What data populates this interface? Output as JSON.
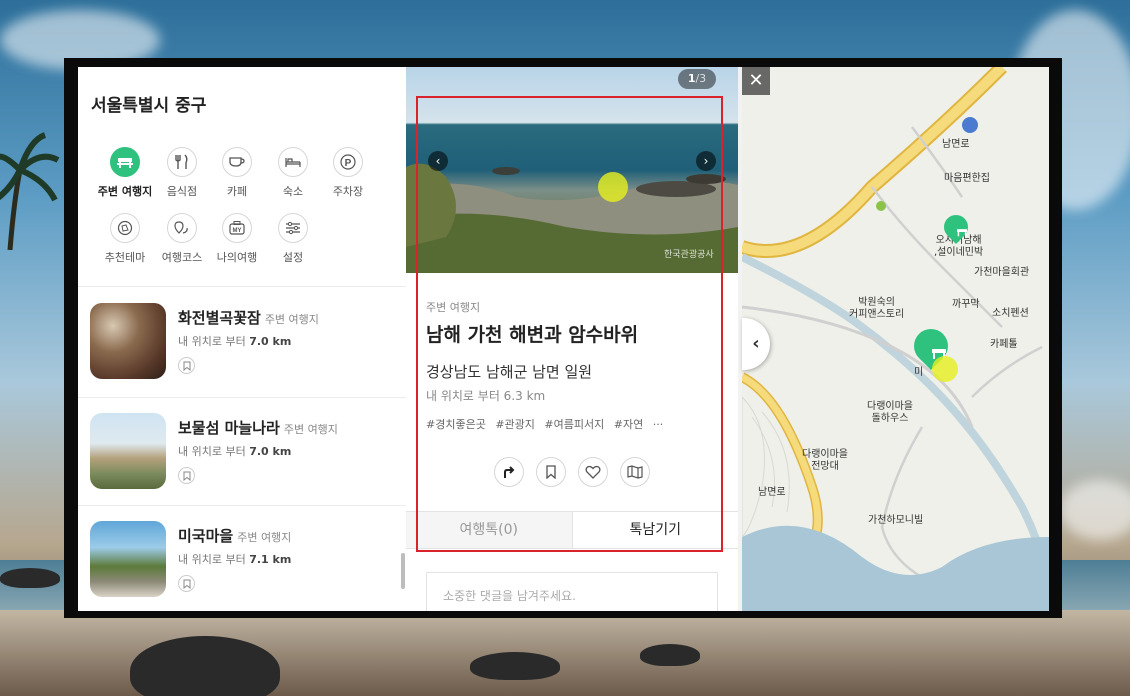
{
  "left_panel": {
    "region_title": "서울특별시 중구",
    "categories": [
      {
        "label": "주변 여행지",
        "icon": "bench-icon",
        "active": true
      },
      {
        "label": "음식점",
        "icon": "fork-knife-icon"
      },
      {
        "label": "카페",
        "icon": "coffee-cup-icon"
      },
      {
        "label": "숙소",
        "icon": "bed-icon"
      },
      {
        "label": "주차장",
        "icon": "parking-icon"
      },
      {
        "label": "추천테마",
        "icon": "theme-icon"
      },
      {
        "label": "여행코스",
        "icon": "route-icon"
      },
      {
        "label": "나의여행",
        "icon": "my-luggage-icon"
      },
      {
        "label": "설정",
        "icon": "sliders-icon"
      }
    ],
    "places": [
      {
        "name": "화전별곡꽃잠",
        "type": "주변 여행지",
        "dist_prefix": "내 위치로 부터",
        "dist": "7.0 km"
      },
      {
        "name": "보물섬 마늘나라",
        "type": "주변 여행지",
        "dist_prefix": "내 위치로 부터",
        "dist": "7.0 km"
      },
      {
        "name": "미국마을",
        "type": "주변 여행지",
        "dist_prefix": "내 위치로 부터",
        "dist": "7.1 km"
      }
    ]
  },
  "detail": {
    "photo_counter_current": "1",
    "photo_counter_total": "/3",
    "watermark": "한국관광공사",
    "category": "주변 여행지",
    "title": "남해 가천 해변과 암수바위",
    "address": "경상남도 남해군 남면 일원",
    "distance": "내 위치로 부터 6.3 km",
    "tags": [
      "#경치좋은곳",
      "#관광지",
      "#여름피서지",
      "#자연",
      "···"
    ],
    "actions": [
      "directions-icon",
      "bookmark-icon",
      "heart-icon",
      "map-icon"
    ],
    "tabs": {
      "reviews": "여행톡(0)",
      "leave": "톡남기기"
    },
    "comment_placeholder": "소중한 댓글을 남겨주세요."
  },
  "map": {
    "close": "✕",
    "collapse": "‹",
    "labels": {
      "maeum": "마음편한집",
      "oswmi": "오시미남해\n,설이네민박",
      "gacheon_hall": "가천마을회관",
      "bakwonsuk": "박원숙의\n커피앤스토리",
      "kkakkumak": "까꾸막",
      "sochi": "소치펜션",
      "cafe": "카페톨",
      "dareng_dolhouse": "다랭이마을\n돌하우스",
      "dareng_view": "다랭이마을\n전망대",
      "gacheon_hamony": "가천하모니빌",
      "mi": "미",
      "road1": "남면로",
      "road2": "남면로"
    }
  }
}
